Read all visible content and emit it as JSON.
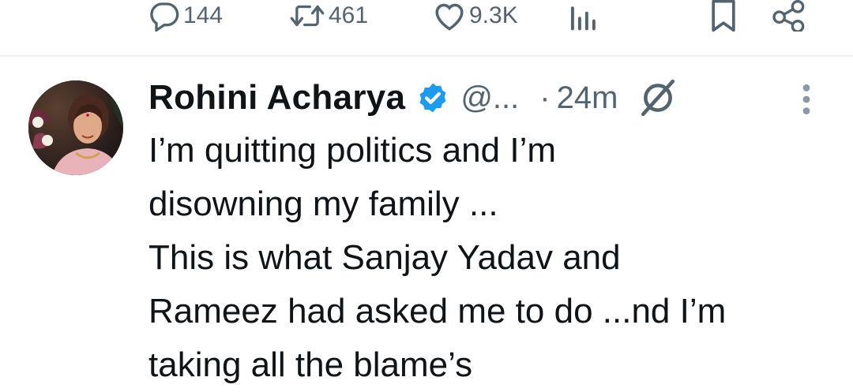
{
  "actions": {
    "reply_count": "144",
    "retweet_count": "461",
    "like_count": "9.3K"
  },
  "tweet": {
    "display_name": "Rohini Acharya",
    "handle": "@...",
    "separator": "·",
    "time": "24m",
    "text": "I’m quitting politics and I’m\ndisowning my family ...\nThis is what Sanjay Yadav and\nRameez had asked me to do ...nd I’m\ntaking all the blame’s"
  },
  "icons": {
    "reply": "reply-icon",
    "retweet": "retweet-icon",
    "like": "heart-icon",
    "views": "views-icon",
    "bookmark": "bookmark-icon",
    "share": "share-icon",
    "verified": "verified-badge-icon",
    "grok": "grok-icon",
    "more": "more-vertical-icon"
  },
  "colors": {
    "text_primary": "#0f1419",
    "text_secondary": "#536471",
    "verified_blue": "#1d9bf0",
    "divider": "#eff3f4"
  }
}
